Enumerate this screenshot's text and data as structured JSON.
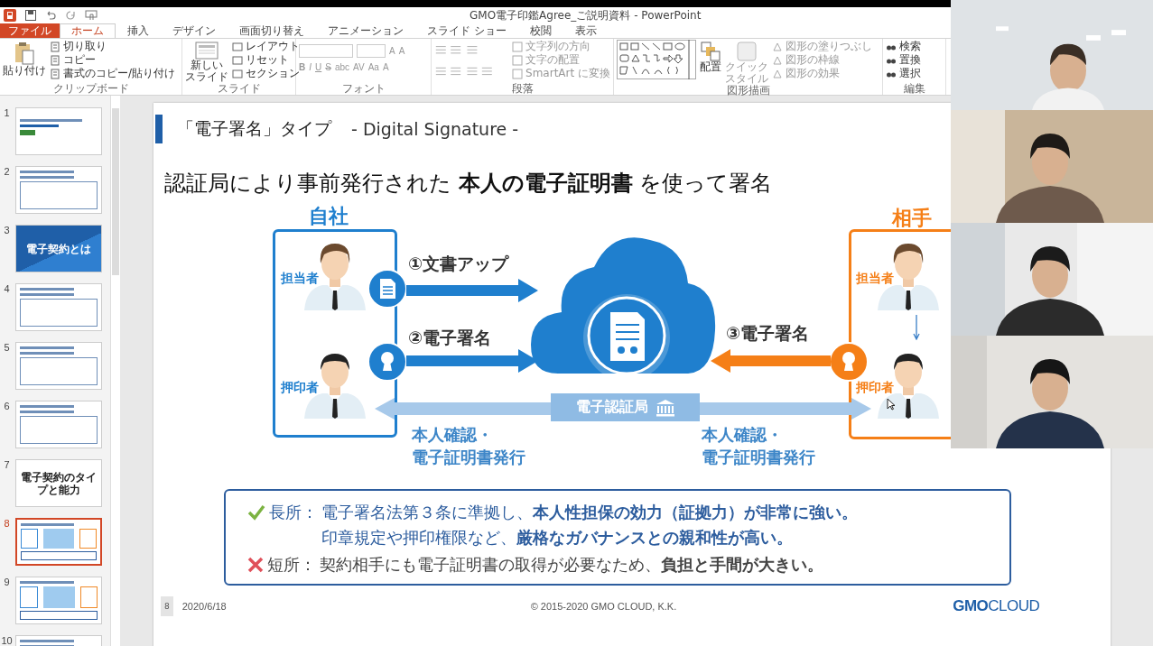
{
  "window": {
    "title": "GMO電子印鑑Agree_ご説明資料 - PowerPoint"
  },
  "tabs": [
    {
      "label": "ファイル",
      "selected": false,
      "kind": "file"
    },
    {
      "label": "ホーム",
      "selected": true,
      "kind": "tab"
    },
    {
      "label": "挿入",
      "selected": false,
      "kind": "tab"
    },
    {
      "label": "デザイン",
      "selected": false,
      "kind": "tab"
    },
    {
      "label": "画面切り替え",
      "selected": false,
      "kind": "tab"
    },
    {
      "label": "アニメーション",
      "selected": false,
      "kind": "tab"
    },
    {
      "label": "スライド ショー",
      "selected": false,
      "kind": "tab"
    },
    {
      "label": "校閲",
      "selected": false,
      "kind": "tab"
    },
    {
      "label": "表示",
      "selected": false,
      "kind": "tab"
    }
  ],
  "ribbon": {
    "clipboard": {
      "label": "クリップボード",
      "paste": "貼り付け",
      "items": [
        {
          "label": "切り取り",
          "disabled": false
        },
        {
          "label": "コピー",
          "disabled": false
        },
        {
          "label": "書式のコピー/貼り付け",
          "disabled": false
        }
      ]
    },
    "slides": {
      "label": "スライド",
      "new_slide": [
        "新しい",
        "スライド"
      ],
      "items": [
        {
          "label": "レイアウト",
          "disabled": false
        },
        {
          "label": "リセット",
          "disabled": false
        },
        {
          "label": "セクション",
          "disabled": false
        }
      ]
    },
    "font": {
      "label": "フォント",
      "disabled": true,
      "size_buttons": [
        "A",
        "A"
      ],
      "format_buttons": [
        "B",
        "I",
        "U",
        "S",
        "abc",
        "AV",
        "Aa",
        "A"
      ]
    },
    "paragraph": {
      "label": "段落",
      "items": [
        {
          "label": "文字列の方向",
          "disabled": true
        },
        {
          "label": "文字の配置",
          "disabled": true
        },
        {
          "label": "SmartArt に変換",
          "disabled": true
        }
      ]
    },
    "drawing": {
      "label": "図形描画",
      "arrange": "配置",
      "quick_style": [
        "クイック",
        "スタイル"
      ],
      "items": [
        {
          "label": "図形の塗りつぶし",
          "disabled": true
        },
        {
          "label": "図形の枠線",
          "disabled": true
        },
        {
          "label": "図形の効果",
          "disabled": true
        }
      ]
    },
    "editing": {
      "label": "編集",
      "items": [
        {
          "label": "検索",
          "disabled": false
        },
        {
          "label": "置換",
          "disabled": false
        },
        {
          "label": "選択",
          "disabled": false
        }
      ]
    }
  },
  "thumbnails": [
    {
      "number": "1",
      "selected": false,
      "kind": "cover"
    },
    {
      "number": "2",
      "selected": false,
      "kind": "content"
    },
    {
      "number": "3",
      "selected": false,
      "kind": "section",
      "title": "電子契約とは"
    },
    {
      "number": "4",
      "selected": false,
      "kind": "content"
    },
    {
      "number": "5",
      "selected": false,
      "kind": "content"
    },
    {
      "number": "6",
      "selected": false,
      "kind": "content"
    },
    {
      "number": "7",
      "selected": false,
      "kind": "heading",
      "title": "電子契約のタイプと能力"
    },
    {
      "number": "8",
      "selected": true,
      "kind": "diagram"
    },
    {
      "number": "9",
      "selected": false,
      "kind": "diagram"
    },
    {
      "number": "10",
      "selected": false,
      "kind": "content"
    }
  ],
  "slide": {
    "title": "「電子署名」タイプ",
    "subtitle": "- Digital Signature -",
    "headline": "認証局により事前発行された **本人の電子証明書** を使って署名",
    "diagram": {
      "left_party": {
        "label": "自社",
        "people": [
          "担当者",
          "押印者"
        ]
      },
      "right_party": {
        "label": "相手",
        "people": [
          "担当者",
          "押印者"
        ]
      },
      "steps": [
        "①文書アップ",
        "②電子署名",
        "③電子署名"
      ],
      "authority": "電子認証局",
      "issue_labels": [
        [
          "本人確認・",
          "電子証明書発行"
        ],
        [
          "本人確認・",
          "電子証明書発行"
        ]
      ]
    },
    "points": [
      {
        "kind": "pro",
        "label": "長所：",
        "lines": [
          "電子署名法第３条に準拠し、**本人性担保の効力（証拠力）が非常に強い。**",
          "印章規定や押印権限など、**厳格なガバナンスとの親和性が高い。**"
        ]
      },
      {
        "kind": "con",
        "label": "短所：",
        "lines": [
          "契約相手にも電子証明書の取得が必要なため、**負担と手間が大きい。**"
        ]
      }
    ],
    "footer": {
      "page": "8",
      "date": "2020/6/18",
      "copyright": "© 2015-2020 GMO CLOUD, K.K.",
      "logo_bold": "GMO",
      "logo_rest": "CLOUD"
    }
  }
}
